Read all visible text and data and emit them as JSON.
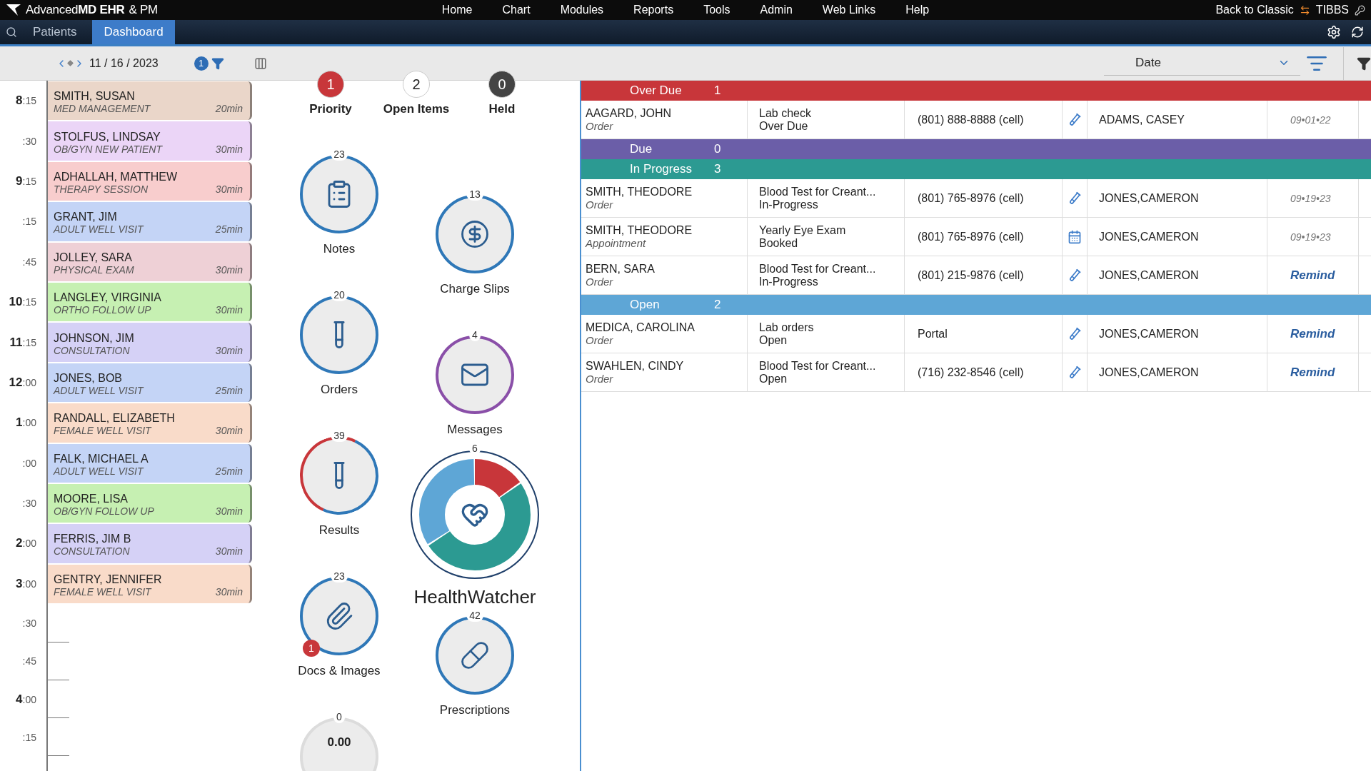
{
  "app_bar": {
    "brand": {
      "prefix": "Advanced",
      "bold": "MD EHR",
      "suffix": "& PM"
    },
    "menu": [
      "Home",
      "Chart",
      "Modules",
      "Reports",
      "Tools",
      "Admin",
      "Web Links",
      "Help"
    ],
    "back_link": "Back to Classic",
    "user": "TIBBS"
  },
  "tabs": [
    {
      "label": "Patients",
      "selected": false
    },
    {
      "label": "Dashboard",
      "selected": true
    }
  ],
  "toolbar": {
    "date": "11 / 16 / 2023",
    "filter_count": "1",
    "sort_field": "Date"
  },
  "schedule": {
    "times": [
      {
        "hour": "8",
        "minute": ":15"
      },
      {
        "minute": ":30"
      },
      {
        "hour": "9",
        "minute": ":15"
      },
      {
        "minute": ":15"
      },
      {
        "minute": ":45"
      },
      {
        "hour": "10",
        "minute": ":15"
      },
      {
        "hour": "11",
        "minute": ":15"
      },
      {
        "hour": "12",
        "minute": ":00"
      },
      {
        "hour": "1",
        "minute": ":00"
      },
      {
        "minute": ":00"
      },
      {
        "minute": ":30"
      },
      {
        "hour": "2",
        "minute": ":00"
      },
      {
        "hour": "3",
        "minute": ":00"
      },
      {
        "minute": ":30"
      },
      {
        "minute": ":45"
      },
      {
        "hour": "4",
        "minute": ":00"
      },
      {
        "minute": ":15"
      }
    ],
    "appointments": [
      {
        "name": "SMITH, SUSAN",
        "type": "MED MANAGEMENT",
        "duration": "20min",
        "color": "#ead6c9"
      },
      {
        "name": "STOLFUS, LINDSAY",
        "type": "OB/GYN NEW PATIENT",
        "duration": "30min",
        "color": "#ebd5f7"
      },
      {
        "name": "ADHALLAH, MATTHEW",
        "type": "THERAPY SESSION",
        "duration": "30min",
        "color": "#f8cdcd"
      },
      {
        "name": "GRANT, JIM",
        "type": "ADULT WELL VISIT",
        "duration": "25min",
        "color": "#c4d4f6"
      },
      {
        "name": "JOLLEY, SARA",
        "type": "PHYSICAL EXAM",
        "duration": "30min",
        "color": "#eed0d6"
      },
      {
        "name": "LANGLEY, VIRGINIA",
        "type": "ORTHO FOLLOW UP",
        "duration": "30min",
        "color": "#c6f0b2"
      },
      {
        "name": "JOHNSON, JIM",
        "type": "CONSULTATION",
        "duration": "30min",
        "color": "#d5d1f6"
      },
      {
        "name": "JONES, BOB",
        "type": "ADULT WELL VISIT",
        "duration": "25min",
        "color": "#c4d4f6"
      },
      {
        "name": "RANDALL, ELIZABETH",
        "type": "FEMALE WELL VISIT",
        "duration": "30min",
        "color": "#f9dbc9"
      },
      {
        "name": "FALK, MICHAEL A",
        "type": "ADULT WELL VISIT",
        "duration": "25min",
        "color": "#c4d4f6"
      },
      {
        "name": "MOORE, LISA",
        "type": "OB/GYN FOLLOW UP",
        "duration": "30min",
        "color": "#c6f0b2"
      },
      {
        "name": "FERRIS, JIM B",
        "type": "CONSULTATION",
        "duration": "30min",
        "color": "#d5d1f6"
      },
      {
        "name": "GENTRY, JENNIFER",
        "type": "FEMALE WELL VISIT",
        "duration": "30min",
        "color": "#f9dbc9"
      }
    ]
  },
  "status_counts": [
    {
      "kind": "priority",
      "count": "1",
      "label": "Priority"
    },
    {
      "kind": "open",
      "count": "2",
      "label": "Open Items"
    },
    {
      "kind": "held",
      "count": "0",
      "label": "Held"
    }
  ],
  "widgets": {
    "left": [
      {
        "kind": "notes",
        "count": "23",
        "label": "Notes"
      },
      {
        "kind": "orders",
        "count": "20",
        "label": "Orders"
      },
      {
        "kind": "results",
        "count": "39",
        "label": "Results"
      },
      {
        "kind": "docs",
        "count": "23",
        "label": "Docs & Images",
        "badge": "1"
      },
      {
        "kind": "balance",
        "count": "0",
        "value": "0.00"
      }
    ],
    "right": [
      {
        "kind": "charges",
        "count": "13",
        "label": "Charge Slips"
      },
      {
        "kind": "messages",
        "count": "4",
        "label": "Messages"
      },
      {
        "kind": "health",
        "count": "6",
        "label": "HealthWatcher"
      },
      {
        "kind": "prescriptions",
        "count": "42",
        "label": "Prescriptions"
      }
    ]
  },
  "worklist": {
    "groups": [
      {
        "title": "Over Due",
        "count": "1",
        "color": "#c8363a",
        "rows": [
          {
            "kind": "order",
            "patient": "AAGARD, JOHN",
            "record_type": "Order",
            "item": "Lab check",
            "status": "Over Due",
            "contact": "(801) 888-8888 (cell)",
            "provider": "ADAMS, CASEY",
            "last": {
              "kind": "date",
              "text": "09•01•22"
            }
          }
        ]
      },
      {
        "title": "Due",
        "count": "0",
        "color": "#6b5ea8"
      },
      {
        "title": "In Progress",
        "count": "3",
        "color": "#2c9a92",
        "rows": [
          {
            "kind": "order",
            "patient": "SMITH, THEODORE",
            "record_type": "Order",
            "item": "Blood Test for Creant...",
            "status": "In-Progress",
            "contact": "(801) 765-8976 (cell)",
            "provider": "JONES,CAMERON",
            "last": {
              "kind": "date",
              "text": "09•19•23"
            }
          },
          {
            "kind": "appointment",
            "patient": "SMITH, THEODORE",
            "record_type": "Appointment",
            "item": "Yearly Eye Exam",
            "status": "Booked",
            "contact": "(801) 765-8976 (cell)",
            "provider": "JONES,CAMERON",
            "last": {
              "kind": "date",
              "text": "09•19•23"
            }
          },
          {
            "kind": "order",
            "patient": "BERN, SARA",
            "record_type": "Order",
            "item": "Blood Test for Creant...",
            "status": "In-Progress",
            "contact": "(801) 215-9876 (cell)",
            "provider": "JONES,CAMERON",
            "last": {
              "kind": "remind",
              "text": "Remind"
            }
          }
        ]
      },
      {
        "title": "Open",
        "count": "2",
        "color": "#5ea6d6",
        "rows": [
          {
            "kind": "order",
            "patient": "MEDICA, CAROLINA",
            "record_type": "Order",
            "item": "Lab orders",
            "status": "Open",
            "contact": "Portal",
            "provider": "JONES,CAMERON",
            "last": {
              "kind": "remind",
              "text": "Remind"
            }
          },
          {
            "kind": "order",
            "patient": "SWAHLEN, CINDY",
            "record_type": "Order",
            "item": "Blood Test for Creant...",
            "status": "Open",
            "contact": "(716) 232-8546 (cell)",
            "provider": "JONES,CAMERON",
            "last": {
              "kind": "remind",
              "text": "Remind"
            }
          }
        ]
      }
    ]
  }
}
